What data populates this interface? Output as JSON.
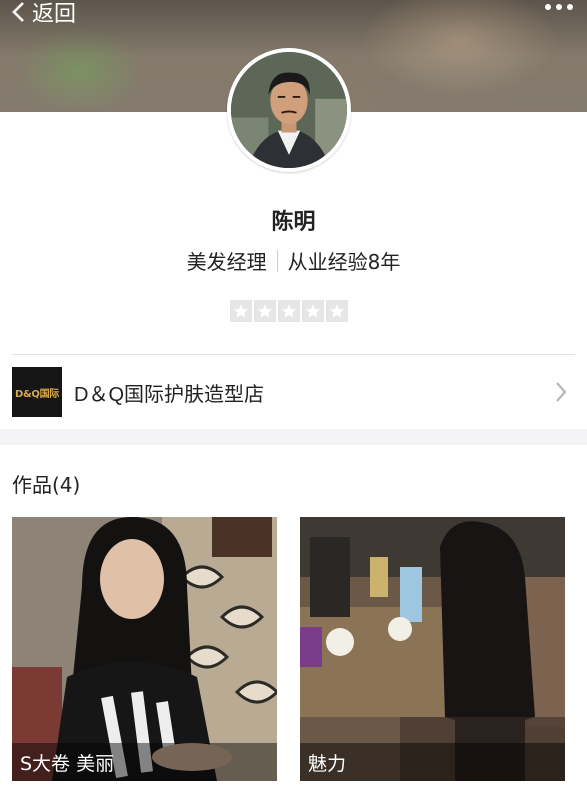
{
  "header": {
    "back_label": "返回",
    "more_icon": "more-horizontal-icon",
    "back_icon": "chevron-left-icon"
  },
  "profile": {
    "name": "陈明",
    "title": "美发经理",
    "experience": "从业经验8年",
    "rating": 0,
    "rating_max": 5
  },
  "shop": {
    "logo_text": "D&Q国际",
    "name": "D＆Q国际护肤造型店",
    "chevron_icon": "chevron-right-icon"
  },
  "works": {
    "title": "作品(4)",
    "items": [
      {
        "caption": "S大卷 美丽"
      },
      {
        "caption": "魅力"
      }
    ]
  },
  "colors": {
    "background": "#f3f3f5",
    "card": "#ffffff",
    "text": "#222222",
    "star_bg": "#e6e6e6"
  }
}
